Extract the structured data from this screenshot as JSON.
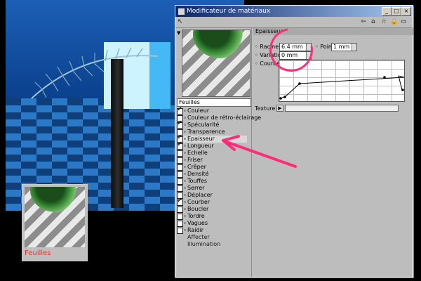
{
  "window": {
    "title": "Modificateur de matériaux",
    "buttons": [
      "_",
      "□",
      "×"
    ]
  },
  "material_preview": {
    "field_name": "Feuilles"
  },
  "viewport_thumbnail": {
    "caption": "Feuilles",
    "caption_color": "#ff2b2b"
  },
  "channels": [
    {
      "label": "Couleur",
      "checked": true
    },
    {
      "label": "Couleur de rétro-éclairage",
      "checked": false
    },
    {
      "label": "Spécularité",
      "checked": true
    },
    {
      "label": "Transparence",
      "checked": false
    },
    {
      "label": "Epaisseur",
      "checked": true,
      "selected": true
    },
    {
      "label": "Longueur",
      "checked": true
    },
    {
      "label": "Echelle",
      "checked": false
    },
    {
      "label": "Friser",
      "checked": false
    },
    {
      "label": "Crêper",
      "checked": false
    },
    {
      "label": "Densité",
      "checked": false
    },
    {
      "label": "Touffes",
      "checked": false
    },
    {
      "label": "Serrer",
      "checked": false
    },
    {
      "label": "Déplacer",
      "checked": false
    },
    {
      "label": "Courber",
      "checked": true
    },
    {
      "label": "Boucler",
      "checked": false
    },
    {
      "label": "Tordre",
      "checked": false
    },
    {
      "label": "Vagues",
      "checked": false
    },
    {
      "label": "Raidir",
      "checked": false
    },
    {
      "label": "Affecter",
      "checked": null
    },
    {
      "label": "Illumination",
      "checked": null
    }
  ],
  "epaisseur": {
    "section_title": "Epaisseur",
    "racine_label": "Racine",
    "racine_value": "6.4 mm",
    "pointe_label": "Pointe",
    "pointe_value": "1 mm",
    "variation_label": "Variation",
    "variation_value": "0 mm",
    "courbe_label": "Courbe",
    "texture_label": "Texture"
  },
  "colors": {
    "annotation": "#ff2d79",
    "title_bar": "#0a246a"
  }
}
